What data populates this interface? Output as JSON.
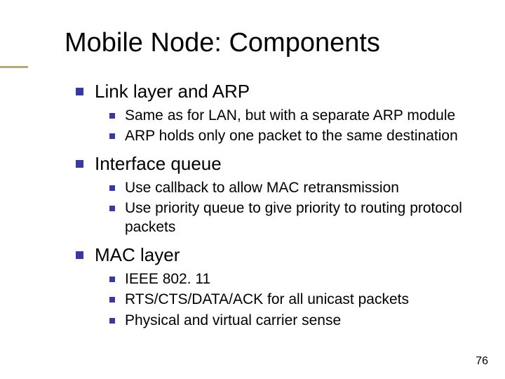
{
  "title": "Mobile Node: Components",
  "sections": [
    {
      "heading": "Link layer and ARP",
      "items": [
        "Same as for LAN, but with a separate ARP module",
        "ARP holds only one packet to the same destination"
      ]
    },
    {
      "heading": "Interface queue",
      "items": [
        "Use callback to allow MAC retransmission",
        "Use priority queue to give priority to routing protocol packets"
      ]
    },
    {
      "heading": "MAC layer",
      "items": [
        "IEEE 802. 11",
        "RTS/CTS/DATA/ACK for all unicast packets",
        "Physical and virtual carrier sense"
      ]
    }
  ],
  "page_number": "76"
}
